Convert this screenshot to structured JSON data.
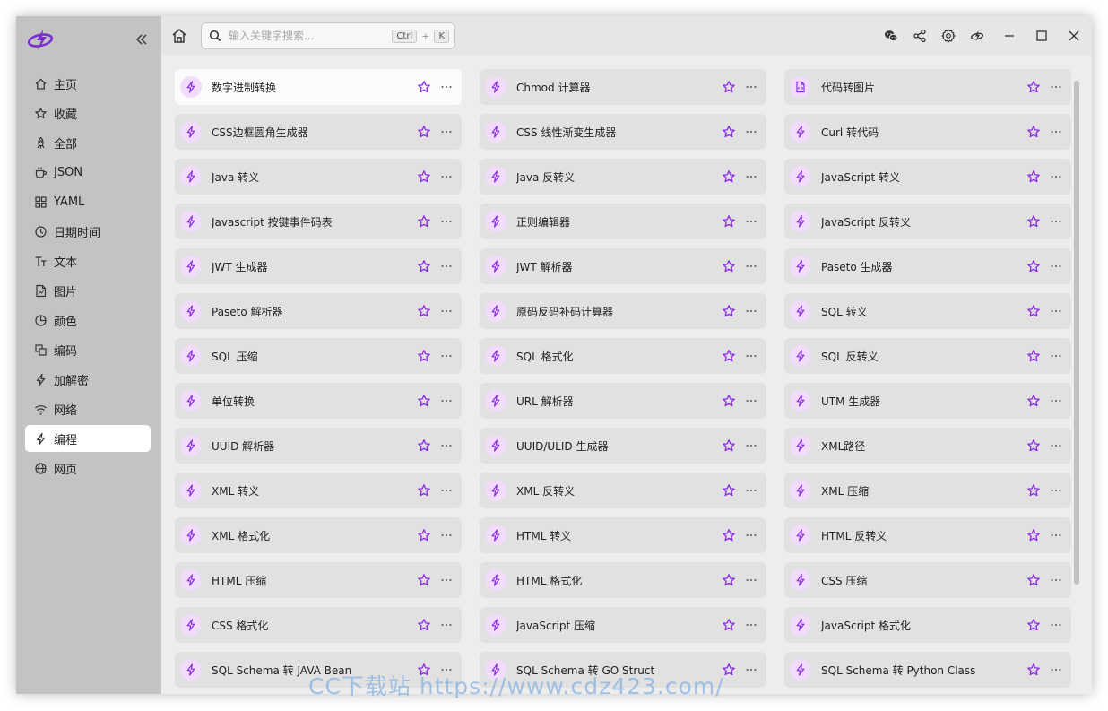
{
  "sidebar": {
    "items": [
      {
        "label": "主页",
        "icon": "home-icon"
      },
      {
        "label": "收藏",
        "icon": "star-icon"
      },
      {
        "label": "全部",
        "icon": "rocket-icon"
      },
      {
        "label": "JSON",
        "icon": "cup-icon"
      },
      {
        "label": "YAML",
        "icon": "grid-icon"
      },
      {
        "label": "日期时间",
        "icon": "clock-icon"
      },
      {
        "label": "文本",
        "icon": "text-icon"
      },
      {
        "label": "图片",
        "icon": "file-image-icon"
      },
      {
        "label": "颜色",
        "icon": "pie-icon"
      },
      {
        "label": "编码",
        "icon": "copy-icon"
      },
      {
        "label": "加解密",
        "icon": "bolt-icon"
      },
      {
        "label": "网络",
        "icon": "wifi-icon"
      },
      {
        "label": "编程",
        "icon": "bolt-icon",
        "active": true
      },
      {
        "label": "网页",
        "icon": "globe-icon"
      }
    ]
  },
  "search": {
    "placeholder": "输入关键字搜索...",
    "key1": "Ctrl",
    "plus": "+",
    "key2": "K"
  },
  "accent_color": "#8a2be2",
  "tools": [
    "数字进制转换",
    "Chmod 计算器",
    "代码转图片",
    "CSS边框圆角生成器",
    "CSS 线性渐变生成器",
    "Curl 转代码",
    "Java 转义",
    "Java 反转义",
    "JavaScript 转义",
    "Javascript 按键事件码表",
    "正则编辑器",
    "JavaScript 反转义",
    "JWT 生成器",
    "JWT 解析器",
    "Paseto 生成器",
    "Paseto 解析器",
    "原码反码补码计算器",
    "SQL 转义",
    "SQL 压缩",
    "SQL 格式化",
    "SQL 反转义",
    "单位转换",
    "URL 解析器",
    "UTM 生成器",
    "UUID 解析器",
    "UUID/ULID 生成器",
    "XML路径",
    "XML 转义",
    "XML 反转义",
    "XML 压缩",
    "XML 格式化",
    "HTML 转义",
    "HTML 反转义",
    "HTML 压缩",
    "HTML 格式化",
    "CSS 压缩",
    "CSS 格式化",
    "JavaScript 压缩",
    "JavaScript 格式化",
    "SQL Schema 转 JAVA Bean",
    "SQL Schema 转 GO Struct",
    "SQL Schema 转 Python Class"
  ],
  "watermark": "CC下载站 https://www.cdz423.com/"
}
